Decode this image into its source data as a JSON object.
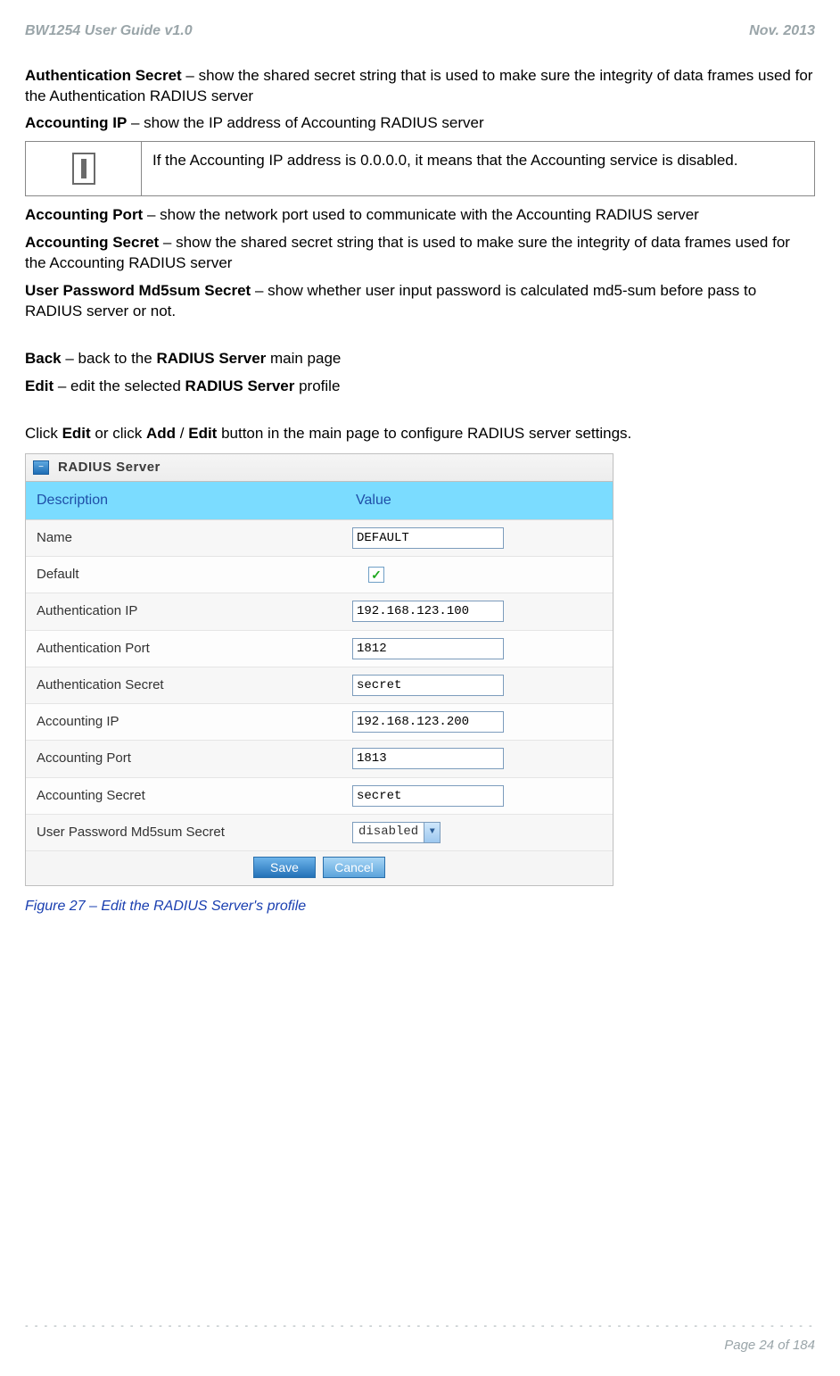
{
  "header": {
    "left": "BW1254 User Guide v1.0",
    "right": "Nov.  2013"
  },
  "body": {
    "auth_secret_label": "Authentication Secret",
    "auth_secret_text": " – show the shared secret string that is used to make sure the integrity of data frames used for the Authentication RADIUS server",
    "acct_ip_label": "Accounting IP",
    "acct_ip_text": " – show the IP address of Accounting RADIUS server",
    "note_text": "If the Accounting IP address is 0.0.0.0, it means that the Accounting service is disabled.",
    "acct_port_label": "Accounting Port",
    "acct_port_text": " – show the network port used to communicate with the Accounting RADIUS server",
    "acct_secret_label": "Accounting Secret",
    "acct_secret_text": " – show the shared secret string that is used to make sure the integrity of data frames used for the Accounting RADIUS server",
    "pw_md5_label": "User Password Md5sum Secret",
    "pw_md5_text": " – show whether user input password is calculated md5-sum before pass to RADIUS server or not.",
    "back_label": "Back",
    "back_text_1": " – back to the ",
    "back_bold": "RADIUS Server",
    "back_text_2": " main page",
    "edit_label": "Edit",
    "edit_text_1": " – edit the selected ",
    "edit_bold": "RADIUS Server",
    "edit_text_2": " profile",
    "click_1": "Click ",
    "click_edit": "Edit",
    "click_2": " or click ",
    "click_add": "Add",
    "click_3": " / ",
    "click_edit2": "Edit",
    "click_4": " button in the main page to configure RADIUS server settings."
  },
  "panel": {
    "title": "RADIUS Server",
    "head_desc": "Description",
    "head_val": "Value",
    "rows": [
      {
        "label": "Name",
        "type": "text",
        "value": "DEFAULT"
      },
      {
        "label": "Default",
        "type": "checkbox",
        "value": "✓"
      },
      {
        "label": "Authentication IP",
        "type": "text",
        "value": "192.168.123.100"
      },
      {
        "label": "Authentication Port",
        "type": "text",
        "value": "1812"
      },
      {
        "label": "Authentication Secret",
        "type": "text",
        "value": "secret"
      },
      {
        "label": "Accounting IP",
        "type": "text",
        "value": "192.168.123.200"
      },
      {
        "label": "Accounting Port",
        "type": "text",
        "value": "1813"
      },
      {
        "label": "Accounting Secret",
        "type": "text",
        "value": "secret"
      },
      {
        "label": "User Password Md5sum Secret",
        "type": "select",
        "value": "disabled"
      }
    ],
    "save": "Save",
    "cancel": "Cancel"
  },
  "caption": "Figure 27 – Edit the RADIUS Server's profile",
  "footer": {
    "page": "Page 24 of 184"
  }
}
